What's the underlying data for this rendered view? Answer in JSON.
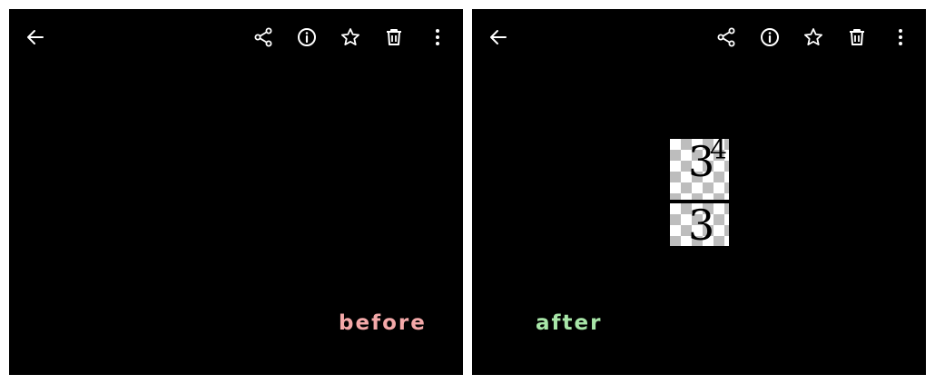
{
  "panels": {
    "before": {
      "caption": "before"
    },
    "after": {
      "caption": "after",
      "image": {
        "numerator_base": "3",
        "numerator_exponent": "4",
        "denominator": "3"
      }
    }
  },
  "toolbar": {
    "icons": [
      "back-arrow-icon",
      "share-icon",
      "info-icon",
      "star-icon",
      "trash-icon",
      "more-vert-icon"
    ]
  },
  "colors": {
    "panel_background": "#000000",
    "icon": "#ffffff",
    "caption_before": "#f4a9a9",
    "caption_after": "#a8e6a8"
  }
}
